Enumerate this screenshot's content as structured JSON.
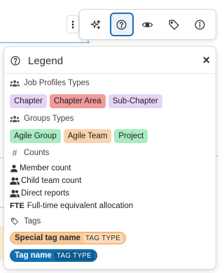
{
  "toolbar": {
    "buttons": [
      {
        "icon": "sparkles-icon",
        "active": false
      },
      {
        "icon": "help-circle-icon",
        "active": true
      },
      {
        "icon": "eye-icon",
        "active": false
      },
      {
        "icon": "tag-icon",
        "active": false
      },
      {
        "icon": "info-icon",
        "active": false
      }
    ]
  },
  "legend": {
    "title": "Legend",
    "close_label": "×",
    "job_profiles": {
      "title": "Job Profiles Types",
      "chips": [
        {
          "label": "Chapter",
          "color": "#e6d4f7"
        },
        {
          "label": "Chapter Area",
          "color": "#f09a9a"
        },
        {
          "label": "Sub-Chapter",
          "color": "#e6d4f7"
        }
      ]
    },
    "groups": {
      "title": "Groups Types",
      "chips": [
        {
          "label": "Agile Group",
          "color": "#a9ecc4"
        },
        {
          "label": "Agile Team",
          "color": "#f9d3ae"
        },
        {
          "label": "Project",
          "color": "#a9ecc4"
        }
      ]
    },
    "counts": {
      "title": "Counts",
      "hash": "#",
      "items": [
        {
          "label": "Member count",
          "icon": "user-icon"
        },
        {
          "label": "Child team count",
          "icon": "users-icon"
        },
        {
          "label": "Direct reports",
          "icon": "users-icon"
        },
        {
          "label": "Full-time equivalent allocation",
          "prefix": "FTE"
        }
      ]
    },
    "tags": {
      "title": "Tags",
      "items": [
        {
          "name": "Special tag name",
          "type": "TAG TYPE",
          "style": "special"
        },
        {
          "name": "Tag name",
          "type": "TAG TYPE",
          "style": "blue"
        }
      ]
    }
  }
}
